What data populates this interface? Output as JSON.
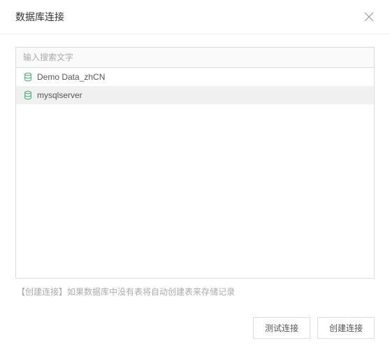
{
  "dialog": {
    "title": "数据库连接",
    "search_placeholder": "输入搜索文字",
    "connections": [
      {
        "label": "Demo Data_zhCN",
        "selected": false
      },
      {
        "label": "mysqlserver",
        "selected": true
      }
    ],
    "hint": "【创建连接】如果数据库中没有表将自动创建表来存储记录",
    "test_button": "测试连接",
    "create_button": "创建连接"
  }
}
